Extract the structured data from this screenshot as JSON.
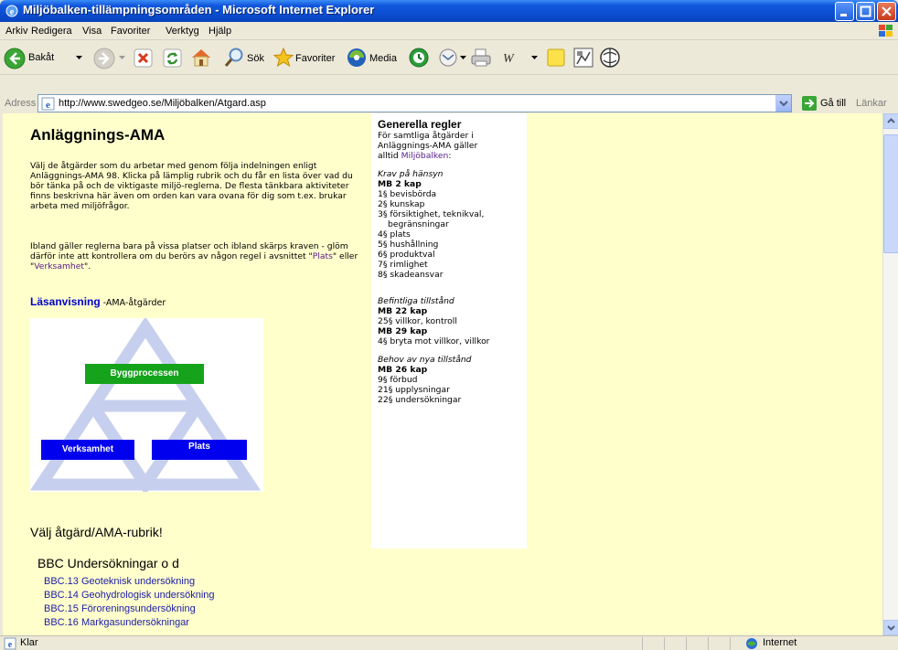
{
  "window": {
    "title": "Miljöbalken-tillämpningsområden - Microsoft Internet Explorer"
  },
  "menu": [
    "Arkiv",
    "Redigera",
    "Visa",
    "Favoriter",
    "Verktyg",
    "Hjälp"
  ],
  "toolbar": {
    "back": "Bakåt",
    "search": "Sök",
    "favorites": "Favoriter",
    "media": "Media"
  },
  "address": {
    "label": "Adress",
    "url": "http://www.swedgeo.se/Miljöbalken/Atgard.asp",
    "go": "Gå till",
    "links": "Länkar"
  },
  "content": {
    "title": "Anläggnings-AMA",
    "p1": "Välj de åtgärder som du arbetar med genom följa indelningen enligt Anläggnings-AMA 98. Klicka på lämplig rubrik och du får en lista över vad du bör tänka på och de viktigaste miljö-reglerna. De flesta tänkbara aktiviteter finns beskrivna här även om orden kan vara ovana för dig som t.ex. brukar arbeta med miljöfrågor.",
    "p2_pre": "Ibland gäller reglerna bara på vissa platser och ibland skärps kraven - glöm därför inte att kontrollera om du berörs av någon regel i avsnittet \"",
    "p2_link1": "Plats",
    "p2_mid": "\" eller \"",
    "p2_link2": "Verksamhet",
    "p2_post": "\".",
    "read_link": "Läsanvisning",
    "read_text": " -AMA-åtgärder",
    "diagram": {
      "top": "Byggprocessen",
      "left": "Verksamhet",
      "right": "Plats"
    },
    "choose": "Välj åtgärd/AMA-rubrik!",
    "bbc_head": "BBC Undersökningar o d",
    "bbc_items": [
      "BBC.13 Geoteknisk undersökning",
      "BBC.14 Geohydrologisk undersökning",
      "BBC.15 Föroreningsundersökning",
      "BBC.16 Markgasundersökningar"
    ]
  },
  "rules": {
    "title": "Generella regler",
    "intro1": "För samtliga åtgärder i",
    "intro2": "Anläggnings-AMA gäller",
    "intro3": "alltid ",
    "intro_link": "Miljöbalken",
    "intro_colon": ":",
    "s1": {
      "heading": "Krav på hänsyn",
      "kap": "MB 2 kap",
      "items": [
        "1§ bevisbörda",
        "2§ kunskap",
        "3§ försiktighet, teknikval,",
        "begränsningar",
        "4§ plats",
        "5§ hushållning",
        "6§ produktval",
        "7§ rimlighet",
        "8§ skadeansvar"
      ]
    },
    "s2": {
      "heading": "Befintliga tillstånd",
      "kap1": "MB 22 kap",
      "item1": "25§ villkor, kontroll",
      "kap2": "MB 29 kap",
      "item2": "4§ bryta mot villkor, villkor"
    },
    "s3": {
      "heading": "Behov av nya tillstånd",
      "kap": "MB 26 kap",
      "items": [
        "9§ förbud",
        "21§ upplysningar",
        "22§ undersökningar"
      ]
    }
  },
  "status": {
    "text": "Klar",
    "zone": "Internet"
  }
}
